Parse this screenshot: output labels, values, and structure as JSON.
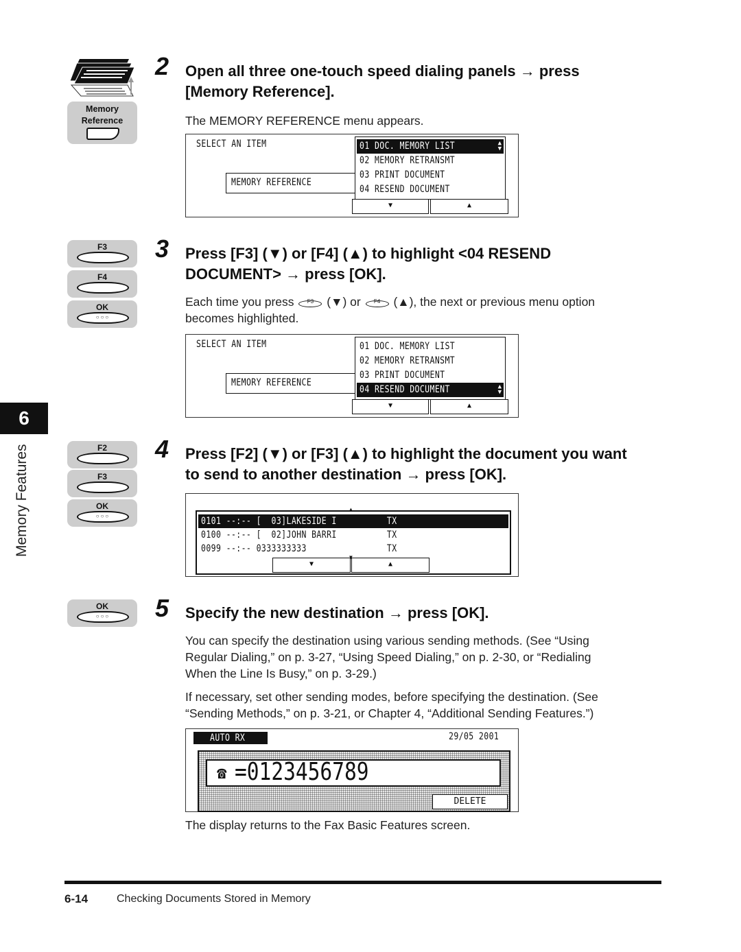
{
  "chapter": {
    "number": "6",
    "label": "Memory Features"
  },
  "icons": {
    "panels": "one-touch-panels-icon",
    "memory_reference_key": {
      "line1": "Memory",
      "line2": "Reference"
    },
    "step3_keys": [
      "F3",
      "F4",
      "OK"
    ],
    "step4_keys": [
      "F2",
      "F3",
      "OK"
    ],
    "step5_keys": [
      "OK"
    ],
    "ok_dots": "○○○"
  },
  "steps": [
    {
      "number": "2",
      "title_line1": "Open all three one-touch speed dialing panels → press",
      "title_line2": "[Memory Reference].",
      "body": "The MEMORY REFERENCE menu appears."
    },
    {
      "number": "3",
      "title_line1": "Press [F3] (▼) or [F4] (▲) to highlight <04 RESEND",
      "title_line2": "DOCUMENT> → press [OK].",
      "body_pre": "Each time you press",
      "body_key1": "F3",
      "body_mid1": "(▼) or",
      "body_key2": "F4",
      "body_mid2": "(▲), the next or previous menu option",
      "body_line2": "becomes highlighted."
    },
    {
      "number": "4",
      "title_line1": "Press [F2] (▼) or [F3] (▲) to highlight the document you want",
      "title_line2": "to send to another destination → press [OK]."
    },
    {
      "number": "5",
      "title_line1": "Specify the new destination → press [OK].",
      "para1": [
        "You can specify the destination using various sending methods. (See “Using",
        "Regular Dialing,” on p. 3-27, “Using Speed Dialing,” on p. 2-30, or “Redialing",
        "When the Line Is Busy,” on p. 3-29.)"
      ],
      "para2": [
        "If necessary, set other sending modes, before specifying the destination. (See",
        "“Sending Methods,” on p. 3-21, or Chapter 4, “Additional Sending Features.”)"
      ],
      "after": "The display returns to the Fax Basic Features screen."
    }
  ],
  "screen1": {
    "heading": "SELECT AN ITEM",
    "context": "MEMORY REFERENCE",
    "items": [
      "01 DOC. MEMORY LIST",
      "02 MEMORY RETRANSMT",
      "03 PRINT DOCUMENT",
      "04 RESEND DOCUMENT"
    ],
    "selected_index": 0,
    "down": "▼",
    "up": "▲"
  },
  "screen2": {
    "heading": "SELECT AN ITEM",
    "context": "MEMORY REFERENCE",
    "items": [
      "01 DOC. MEMORY LIST",
      "02 MEMORY RETRANSMT",
      "03 PRINT DOCUMENT",
      "04 RESEND DOCUMENT"
    ],
    "selected_index": 3,
    "down": "▼",
    "up": "▲"
  },
  "screen3": {
    "rows": [
      {
        "num": "0101",
        "time": "--:--",
        "dest": "[  03]LAKESIDE I",
        "type": "TX"
      },
      {
        "num": "0100",
        "time": "--:--",
        "dest": "[  02]JOHN BARRI",
        "type": "TX"
      },
      {
        "num": "0099",
        "time": "--:--",
        "dest": "0333333333",
        "type": "TX"
      }
    ],
    "selected_index": 0,
    "down": "▼",
    "up": "▲"
  },
  "screen4": {
    "mode": "AUTO RX",
    "date": "29/05 2001",
    "phone_symbol": "☎",
    "number": "=0123456789",
    "delete": "DELETE"
  },
  "footer": {
    "page": "6-14",
    "title": "Checking Documents Stored in Memory"
  }
}
